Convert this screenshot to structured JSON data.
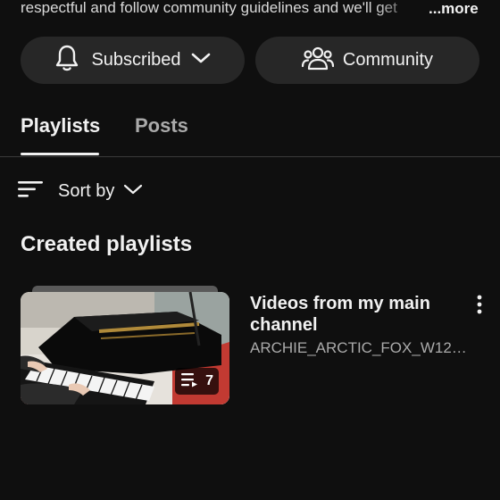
{
  "description": {
    "text": "respectful and follow community guidelines and we'll get",
    "more_label": "...more"
  },
  "actions": {
    "subscribed_label": "Subscribed",
    "community_label": "Community"
  },
  "tabs": [
    {
      "label": "Playlists",
      "active": true
    },
    {
      "label": "Posts",
      "active": false
    }
  ],
  "sort": {
    "label": "Sort by"
  },
  "section": {
    "title": "Created playlists"
  },
  "playlists": [
    {
      "title": "Videos from my main channel",
      "subtitle": "ARCHIE_ARCTIC_FOX_W126 · ...",
      "video_count": "7"
    }
  ],
  "colors": {
    "background": "#0f0f0f",
    "pill": "#272727",
    "text_primary": "#f1f1f1",
    "text_secondary": "#aaaaaa"
  },
  "icons": [
    "bell-icon",
    "chevron-down-icon",
    "people-icon",
    "sort-icon",
    "playlist-icon",
    "more-vert-icon"
  ]
}
